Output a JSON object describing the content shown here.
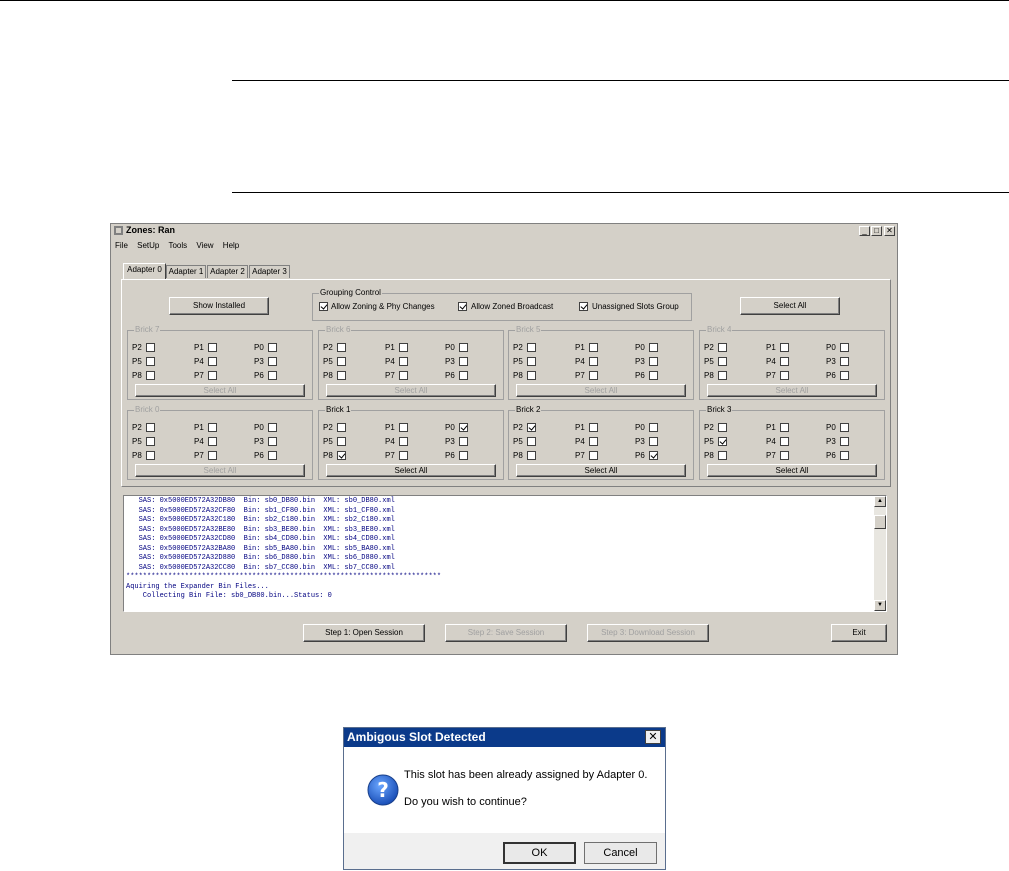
{
  "window": {
    "title": "Zones: Ran",
    "min": "_",
    "max": "□",
    "close": "✕"
  },
  "menu": [
    "File",
    "SetUp",
    "Tools",
    "View",
    "Help"
  ],
  "tabs": [
    "Adapter 0",
    "Adapter 1",
    "Adapter 2",
    "Adapter 3"
  ],
  "show_installed": "Show Installed",
  "grouping": {
    "label": "Grouping Control",
    "allow_zoning": {
      "label": "Allow Zoning & Phy Changes",
      "checked": true
    },
    "allow_broadcast": {
      "label": "Allow Zoned Broadcast",
      "checked": true
    },
    "unassigned": {
      "label": "Unassigned Slots Group",
      "checked": true
    }
  },
  "select_all": "Select All",
  "bricks": [
    {
      "name": "Brick 7",
      "enabled": false,
      "checked": []
    },
    {
      "name": "Brick 6",
      "enabled": false,
      "checked": []
    },
    {
      "name": "Brick 5",
      "enabled": false,
      "checked": []
    },
    {
      "name": "Brick 4",
      "enabled": false,
      "checked": []
    },
    {
      "name": "Brick 0",
      "enabled": false,
      "checked": []
    },
    {
      "name": "Brick 1",
      "enabled": true,
      "checked": [
        "P0",
        "P8"
      ]
    },
    {
      "name": "Brick 2",
      "enabled": true,
      "checked": [
        "P2",
        "P6"
      ]
    },
    {
      "name": "Brick 3",
      "enabled": true,
      "checked": [
        "P5"
      ]
    }
  ],
  "ports": [
    [
      "P2",
      "P1",
      "P0"
    ],
    [
      "P5",
      "P4",
      "P3"
    ],
    [
      "P8",
      "P7",
      "P6"
    ]
  ],
  "log": [
    "   SAS: 0x5000ED572A32DB80  Bin: sb0_DB80.bin  XML: sb0_DB80.xml",
    "   SAS: 0x5000ED572A32CF80  Bin: sb1_CF80.bin  XML: sb1_CF80.xml",
    "   SAS: 0x5000ED572A32C180  Bin: sb2_C180.bin  XML: sb2_C180.xml",
    "   SAS: 0x5000ED572A32BE80  Bin: sb3_BE80.bin  XML: sb3_BE80.xml",
    "   SAS: 0x5000ED572A32CD80  Bin: sb4_CD80.bin  XML: sb4_CD80.xml",
    "   SAS: 0x5000ED572A32BA80  Bin: sb5_BA80.bin  XML: sb5_BA80.xml",
    "   SAS: 0x5000ED572A32D880  Bin: sb6_D880.bin  XML: sb6_D880.xml",
    "   SAS: 0x5000ED572A32CC80  Bin: sb7_CC80.bin  XML: sb7_CC80.xml",
    "***************************************************************************",
    "Aquiring the Expander Bin Files...",
    "    Collecting Bin File: sb0_DB80.bin...Status: 0"
  ],
  "steps": {
    "step1": "Step 1: Open Session",
    "step2": "Step 2: Save Session",
    "step3": "Step 3: Download Session",
    "exit": "Exit"
  },
  "dialog": {
    "title": "Ambigous Slot Detected",
    "close": "✕",
    "message1": "This slot has been already assigned by Adapter 0.",
    "message2": "Do you wish to continue?",
    "ok": "OK",
    "cancel": "Cancel",
    "icon": "question-icon",
    "icon_glyph": "?"
  }
}
